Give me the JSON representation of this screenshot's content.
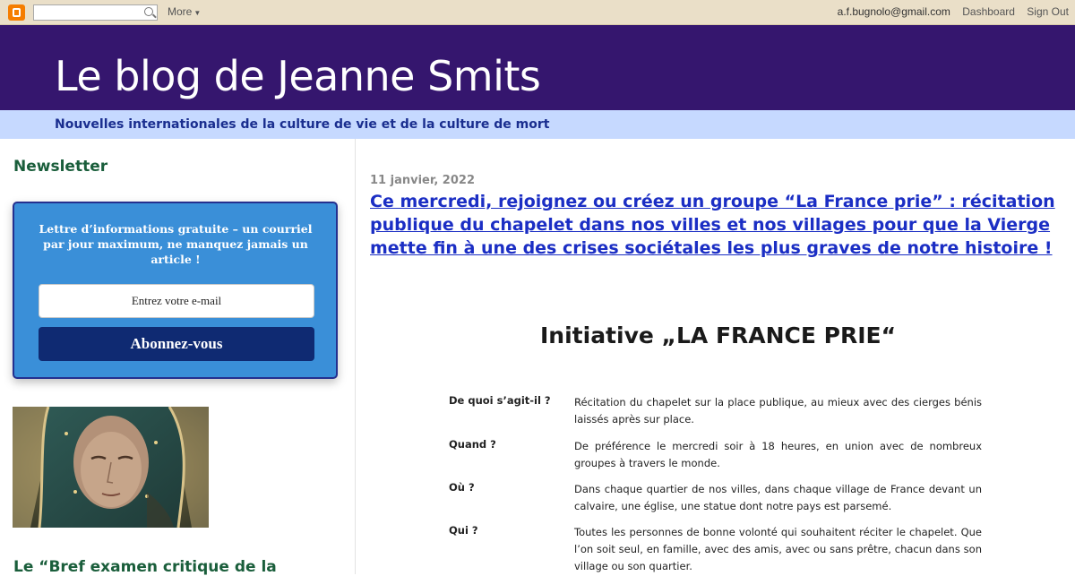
{
  "navbar": {
    "more_label": "More",
    "email": "a.f.bugnolo@gmail.com",
    "dashboard_label": "Dashboard",
    "signout_label": "Sign Out"
  },
  "header": {
    "title": "Le blog de Jeanne Smits",
    "description": "Nouvelles internationales de la culture de vie et de la culture de mort"
  },
  "sidebar": {
    "newsletter_title": "Newsletter",
    "newsletter_text": "Lettre d’informations gratuite – un courriel par jour maximum, ne manquez jamais un article !",
    "email_placeholder": "Entrez votre e-mail",
    "subscribe_label": "Abonnez-vous",
    "next_widget_title": "Le “Bref examen critique de la"
  },
  "post": {
    "date": "11 janvier, 2022",
    "title": "Ce mercredi, rejoignez ou créez un groupe “La France prie” : récitation publique du chapelet dans nos villes et nos villages pour que la Vierge mette fin à une des crises sociétales les plus graves de notre histoire !",
    "doc_heading": "Initiative „LA FRANCE PRIE“",
    "doc_rows": [
      {
        "q": "De quoi s’agit-il ?",
        "a": "Récitation du chapelet sur la place publique, au mieux avec des cierges bénis laissés après sur place."
      },
      {
        "q": "Quand ?",
        "a": "De préférence le mercredi soir à 18 heures, en union avec de nombreux groupes à travers le monde."
      },
      {
        "q": "Où ?",
        "a": "Dans chaque quartier de nos villes, dans chaque village de France devant un calvaire, une église, une statue dont notre pays est parsemé."
      },
      {
        "q": "Qui ?",
        "a": "Toutes les personnes de bonne volonté qui souhaitent réciter le chapelet. Que l’on soit seul, en famille, avec des amis, avec ou sans prêtre, chacun dans son village ou son quartier."
      }
    ]
  },
  "colors": {
    "header_bg": "#35166e",
    "desc_bar": "#c6d9ff",
    "link": "#1b2ec4",
    "widget_title": "#1a5e3b",
    "newsletter_bg": "#3a8fd8",
    "subscribe_bg": "#0f2a72"
  },
  "icons": [
    "blogger-logo-icon",
    "search-icon",
    "chevron-down-icon"
  ]
}
